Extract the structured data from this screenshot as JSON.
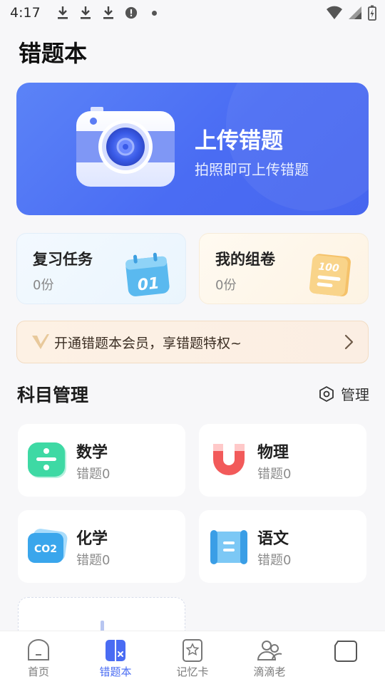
{
  "status_bar": {
    "time": "4:17"
  },
  "page": {
    "title": "错题本"
  },
  "upload": {
    "title": "上传错题",
    "subtitle": "拍照即可上传错题"
  },
  "cards": {
    "review": {
      "title": "复习任务",
      "count": "0份",
      "badge": "01"
    },
    "paper": {
      "title": "我的组卷",
      "count": "0份",
      "badge": "100"
    }
  },
  "vip": {
    "text": "开通错题本会员，享错题特权~"
  },
  "subjects_section": {
    "title": "科目管理",
    "manage_label": "管理"
  },
  "subjects": [
    {
      "name": "数学",
      "count": "错题0"
    },
    {
      "name": "物理",
      "count": "错题0"
    },
    {
      "name": "化学",
      "count": "错题0"
    },
    {
      "name": "语文",
      "count": "错题0"
    }
  ],
  "chem_icon_text": "CO2",
  "tabs": [
    {
      "label": "首页"
    },
    {
      "label": "错题本"
    },
    {
      "label": "记忆卡"
    },
    {
      "label": "滴滴老"
    }
  ],
  "colors": {
    "accent": "#4a6cf3",
    "upload_bg": "#4f70f4"
  }
}
